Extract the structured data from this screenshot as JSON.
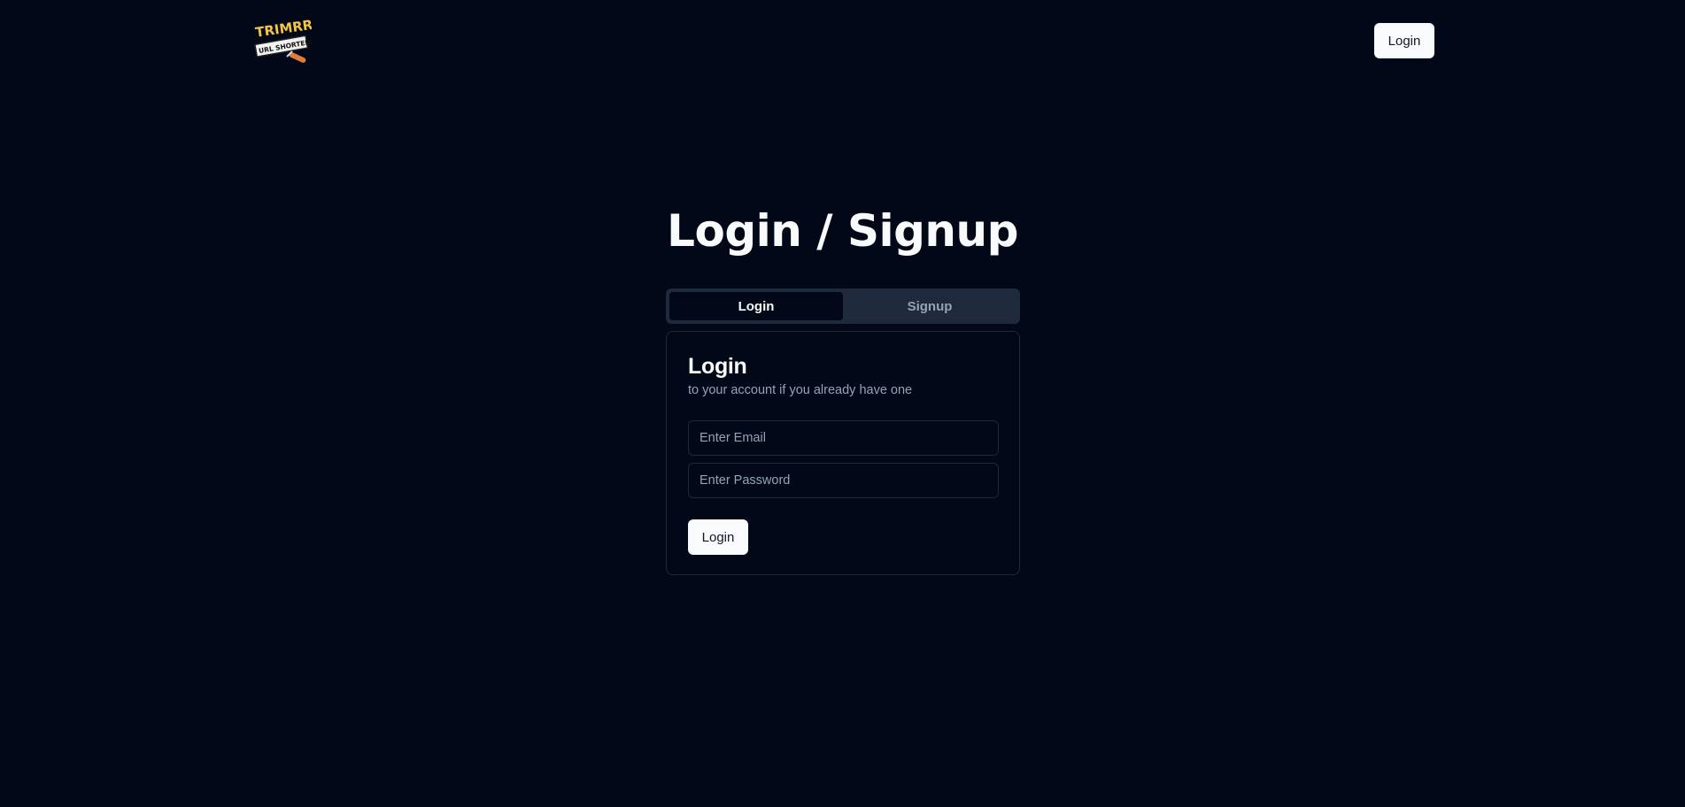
{
  "header": {
    "logo": {
      "line1": "TRIMRR",
      "line2": "URL SHORTENER"
    },
    "login_label": "Login"
  },
  "page": {
    "title": "Login / Signup"
  },
  "tabs": [
    {
      "label": "Login",
      "active": true
    },
    {
      "label": "Signup",
      "active": false
    }
  ],
  "card": {
    "title": "Login",
    "subtitle": "to your account if you already have one",
    "email_placeholder": "Enter Email",
    "password_placeholder": "Enter Password",
    "submit_label": "Login"
  },
  "colors": {
    "background": "#020817",
    "muted": "#1e293b",
    "muted_text": "#94a3b8",
    "primary": "#f8fafc",
    "logo_yellow": "#f5c542",
    "logo_orange": "#e07b39"
  }
}
